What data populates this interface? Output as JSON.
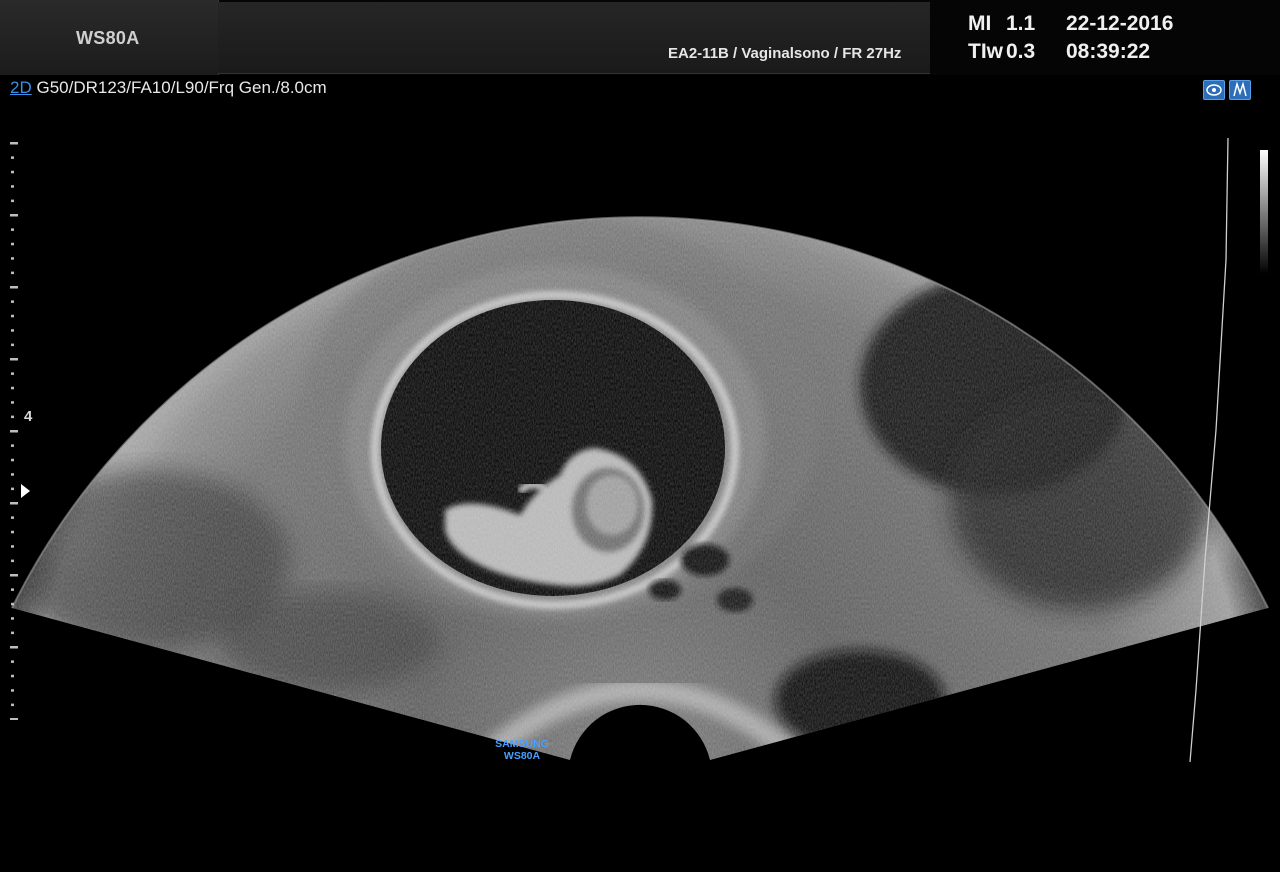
{
  "header": {
    "logo": "WS80A",
    "probe_info": "EA2-11B / Vaginalsono / FR 27Hz",
    "mi_label": "MI",
    "mi_value": "1.1",
    "tl_label": "TIw",
    "tl_value": "0.3",
    "date": "22-12-2016",
    "time": "08:39:22"
  },
  "params": {
    "mode": "2D",
    "gain": "G50",
    "dynamic_range": "DR123",
    "frame_avg": "FA10",
    "line": "L90",
    "frequency": "Frq Gen.",
    "depth": "8.0cm"
  },
  "icons": {
    "right_icon_1": "probe-view-icon",
    "right_icon_2": "body-marker-icon"
  },
  "depth_scale": {
    "label": "4"
  },
  "brand": {
    "line1": "SAMSUNG",
    "line2": "WS80A"
  },
  "colors": {
    "accent_blue": "#3b8fe6",
    "background": "#000000",
    "header_bg": "#1f1f1f"
  }
}
